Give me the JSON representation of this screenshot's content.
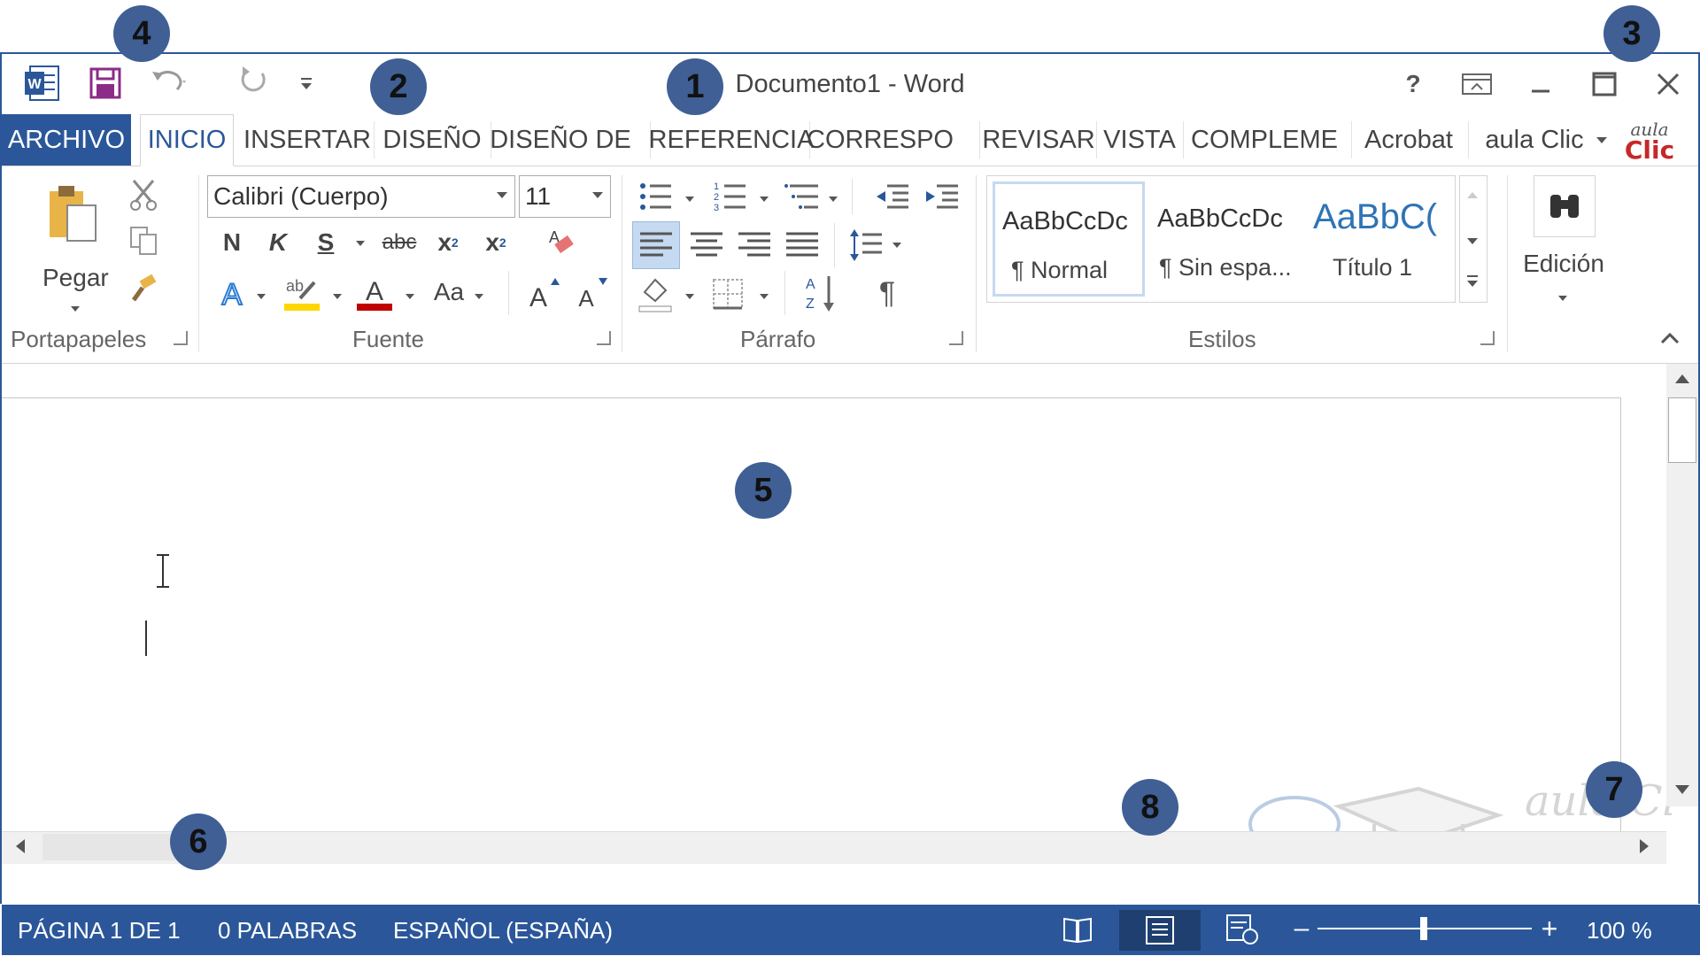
{
  "title": "Documento1 - Word",
  "tabs": [
    "ARCHIVO",
    "INICIO",
    "INSERTAR",
    "DISEÑO",
    "DISEÑO DE",
    "REFERENCIA",
    "CORRESPO",
    "REVISAR",
    "VISTA",
    "COMPLEME",
    "Acrobat"
  ],
  "active_tab": "INICIO",
  "user": "aula Clic",
  "clipboard": {
    "paste_label": "Pegar",
    "group_label": "Portapapeles"
  },
  "font": {
    "name": "Calibri (Cuerpo)",
    "size": "11",
    "group_label": "Fuente",
    "bold": "N",
    "italic": "K",
    "underline": "S",
    "strike": "abc",
    "change_case": "Aa"
  },
  "paragraph": {
    "group_label": "Párrafo",
    "pilcrow": "¶"
  },
  "styles": {
    "group_label": "Estilos",
    "items": [
      {
        "sample": "AaBbCcDc",
        "name": "¶ Normal"
      },
      {
        "sample": "AaBbCcDc",
        "name": "¶ Sin espa..."
      },
      {
        "sample": "AaBbC(",
        "name": "Título 1"
      }
    ]
  },
  "editing": {
    "label": "Edición"
  },
  "status": {
    "page": "PÁGINA 1 DE 1",
    "words": "0 PALABRAS",
    "language": "ESPAÑOL (ESPAÑA)",
    "zoom": "100 %"
  },
  "zoom_level": 0.5,
  "badges": [
    "1",
    "2",
    "3",
    "4",
    "5",
    "6",
    "7",
    "8"
  ],
  "watermark": "aula Clic",
  "colors": {
    "accent": "#2b579a",
    "badge": "#3f5f95"
  }
}
